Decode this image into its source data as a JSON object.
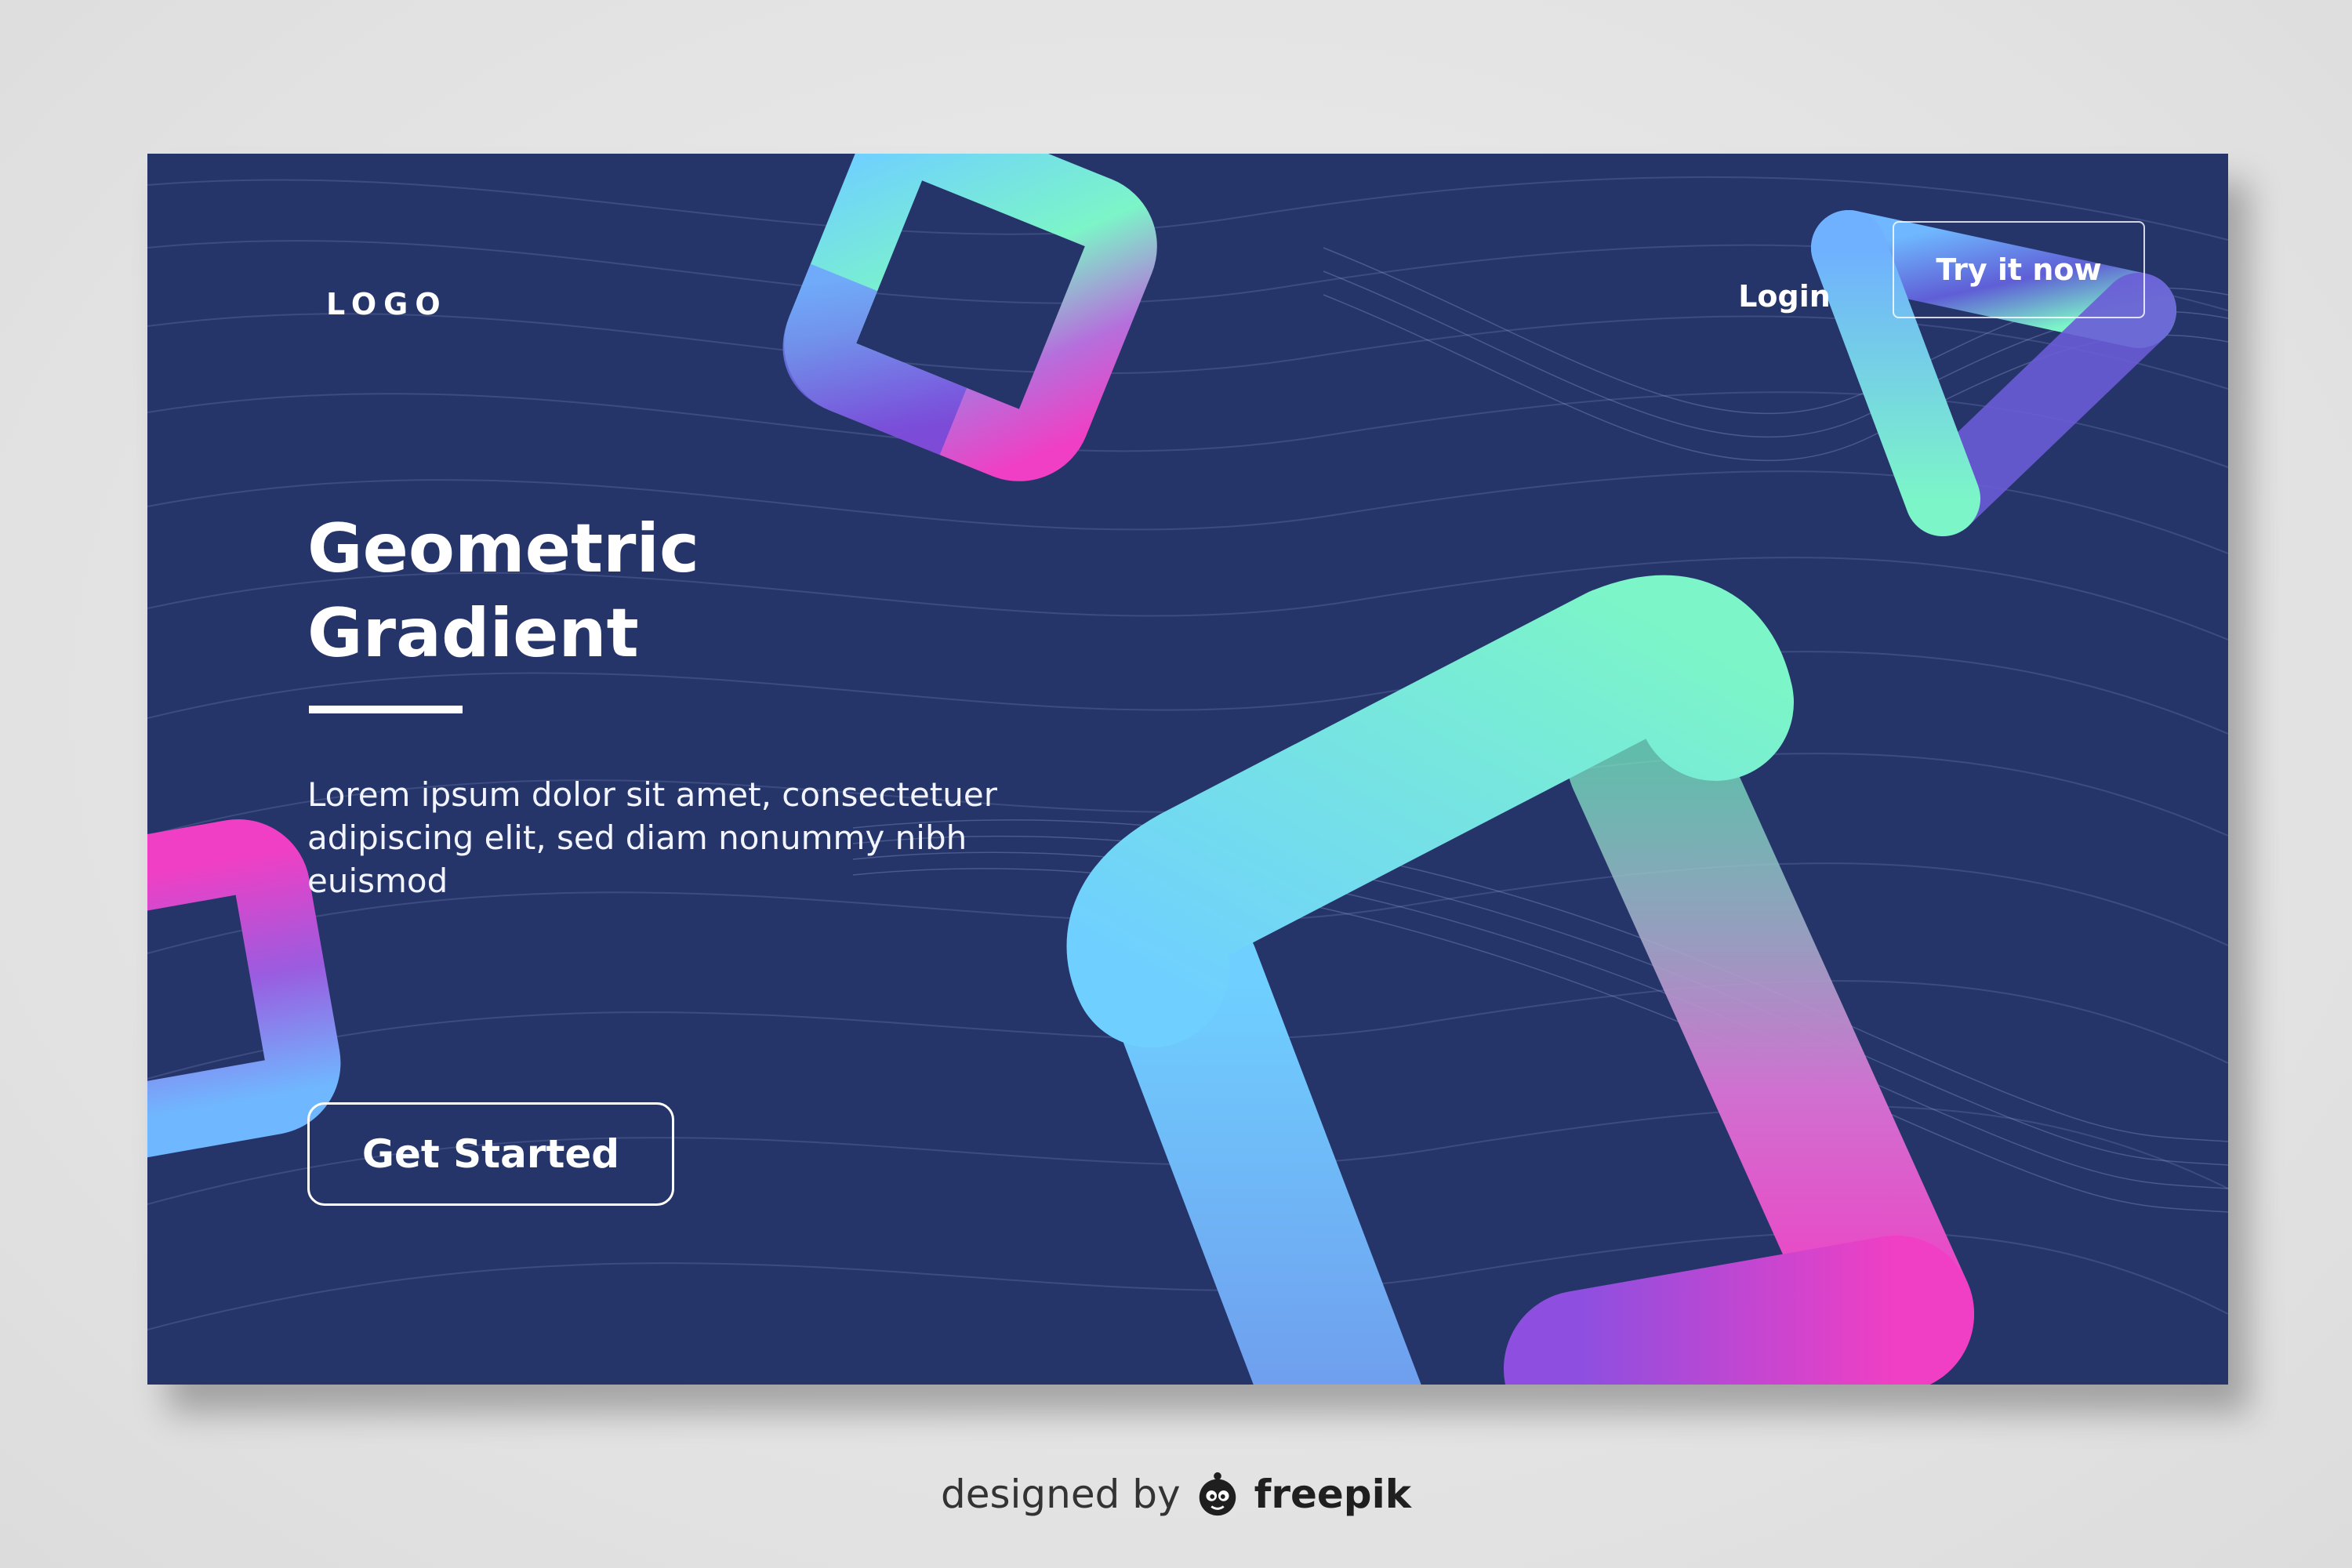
{
  "header": {
    "logo": "LOGO",
    "login_label": "Login",
    "cta_label": "Try it now"
  },
  "hero": {
    "title_line1": "Geometric",
    "title_line2": "Gradient",
    "body": "Lorem ipsum dolor sit amet, consectetuer adipiscing elit, sed diam nonummy nibh euismod",
    "button_label": "Get Started"
  },
  "footer": {
    "credit_prefix": "designed by",
    "credit_brand": "freepik",
    "brand_icon": "freepik-mascot-icon"
  },
  "colors": {
    "background": "#263569",
    "gradient_pink": "#f03fc4",
    "gradient_mint": "#7cf5c8",
    "gradient_blue": "#6fd0ff",
    "gradient_purple": "#6f48d8"
  }
}
